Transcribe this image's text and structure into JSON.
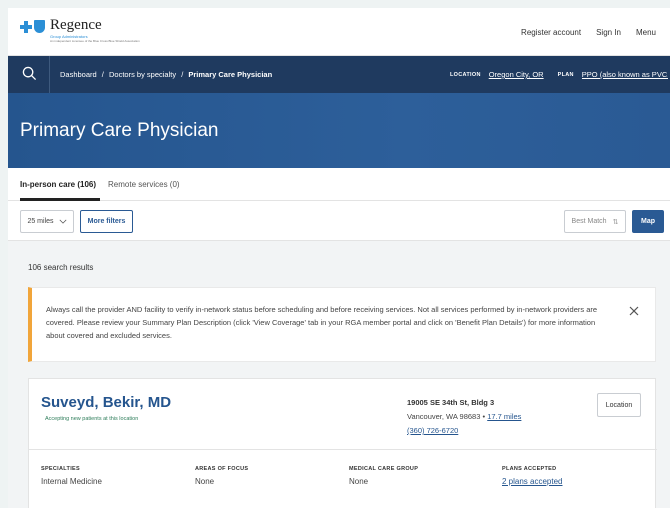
{
  "brand": {
    "name": "Regence",
    "sub1": "Group Administrators",
    "sub2": "An independent Licensee of the Blue Cross Blue Shield Association",
    "color": "#2b8fd6"
  },
  "topnav": {
    "register": "Register account",
    "signin": "Sign In",
    "menu": "Menu"
  },
  "breadcrumb": {
    "dashboard": "Dashboard",
    "sep": "/",
    "specialty": "Doctors by specialty",
    "current": "Primary Care Physician"
  },
  "location": {
    "label": "LOCATION",
    "value": "Oregon City, OR",
    "plan_label": "PLAN",
    "plan_value": "PPO (also known as PVC..."
  },
  "hero": {
    "title": "Primary Care Physician"
  },
  "tabs": [
    {
      "label": "In-person care (106)",
      "active": true
    },
    {
      "label": "Remote services (0)",
      "active": false
    }
  ],
  "filters": {
    "distance": "25 miles",
    "more": "More filters",
    "sort": "Best Match",
    "map": "Map"
  },
  "results": {
    "count": "106 search results",
    "alert": "Always call the provider AND facility to verify in-network status before scheduling and before receiving services. Not all services performed by in-network providers are covered. Please review your Summary Plan Description (click 'View Coverage' tab in your RGA member portal and click on 'Benefit Plan Details') for more information about covered and excluded services."
  },
  "provider": {
    "name": "Suveyd, Bekir, MD",
    "accepting": "Accepting new patients at this location",
    "street": "19005 SE 34th St, Bldg 3",
    "city": "Vancouver, WA 98683",
    "bullet": "•",
    "distance": "17.7 miles",
    "phone": "(360) 726-6720",
    "location_button": "Location",
    "columns": [
      {
        "header": "SPECIALTIES",
        "value": "Internal Medicine"
      },
      {
        "header": "AREAS OF FOCUS",
        "value": "None"
      },
      {
        "header": "MEDICAL CARE GROUP",
        "value": "None"
      },
      {
        "header": "PLANS ACCEPTED",
        "value": "2 plans accepted"
      }
    ]
  },
  "colors": {
    "navy": "#1f3a5f",
    "hero": "#2a5a94",
    "alert_accent": "#f1a53a",
    "link": "#25558e",
    "accepting": "#2e7d5a"
  }
}
